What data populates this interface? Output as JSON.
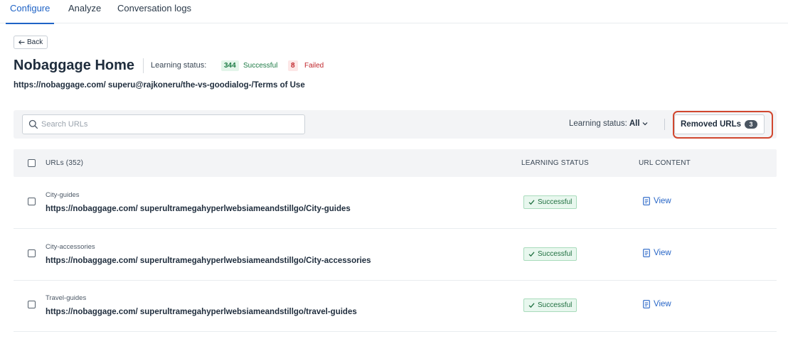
{
  "tabs": [
    {
      "label": "Configure",
      "active": true
    },
    {
      "label": "Analyze",
      "active": false
    },
    {
      "label": "Conversation logs",
      "active": false
    }
  ],
  "back": {
    "label": "Back",
    "icon": "arrow-left-icon"
  },
  "header": {
    "title": "Nobaggage Home",
    "learning_status_label": "Learning status:",
    "success_count": "344",
    "success_label": "Successful",
    "failed_count": "8",
    "failed_label": "Failed",
    "path": "https://nobaggage.com/ superu@rajkoneru/the-vs-goodialog-/Terms of Use"
  },
  "toolbar": {
    "search_placeholder": "Search URLs",
    "search_value": "",
    "filter_label": "Learning status:",
    "filter_value": "All",
    "removed_label": "Removed URLs",
    "removed_count": "3"
  },
  "table": {
    "columns": {
      "urls": "URLs (352)",
      "learning_status": "LEARNING STATUS",
      "url_content": "URL CONTENT"
    },
    "rows": [
      {
        "name": "City-guides",
        "url": "https://nobaggage.com/ superultramegahyperlwebsiameandstillgo/City-guides",
        "status": "Successful",
        "action": "View"
      },
      {
        "name": "City-accessories",
        "url": "https://nobaggage.com/ superultramegahyperlwebsiameandstillgo/City-accessories",
        "status": "Successful",
        "action": "View"
      },
      {
        "name": "Travel-guides",
        "url": "https://nobaggage.com/ superultramegahyperlwebsiameandstillgo/travel-guides",
        "status": "Successful",
        "action": "View"
      }
    ]
  },
  "colors": {
    "accent": "#1f63c6",
    "success": "#1d7a45",
    "failed": "#c0272d",
    "highlight": "#d1472f"
  }
}
